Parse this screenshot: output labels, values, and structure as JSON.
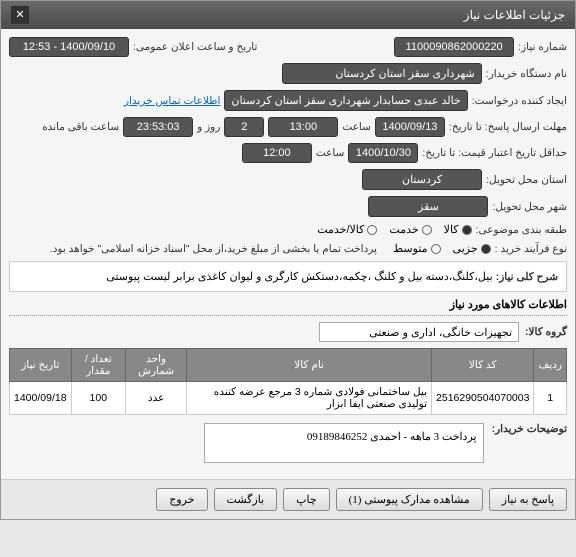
{
  "window": {
    "title": "جزئیات اطلاعات نیاز",
    "close": "✕"
  },
  "fields": {
    "need_number_label": "شماره نیاز:",
    "need_number_value": "1100090862000220",
    "announce_date_label": "تاریخ و ساعت اعلان عمومی:",
    "announce_date_value": "1400/09/10 - 12:53",
    "buyer_org_label": "نام دستگاه خریدار:",
    "buyer_org_value": "شهرداری سقز استان کردستان",
    "requester_label": "ایجاد کننده درخواست:",
    "requester_value": "خالد عبدی حسابدار شهرداری سقز استان کردستان",
    "contact_info_link": "اطلاعات تماس خریدار",
    "deadline_label": "مهلت ارسال پاسخ: تا تاریخ:",
    "deadline_date": "1400/09/13",
    "time_label": "ساعت",
    "deadline_time": "13:00",
    "days_value": "2",
    "days_label": "روز و",
    "remaining_time": "23:53:03",
    "remaining_label": "ساعت باقی مانده",
    "validity_label": "حداقل تاریخ اعتبار قیمت: تا تاریخ:",
    "validity_date": "1400/10/30",
    "validity_time": "12:00",
    "province_label": "استان محل تحویل:",
    "province_value": "کردستان",
    "city_label": "شهر محل تحویل:",
    "city_value": "سقز",
    "category_label": "طبقه بندی موضوعی:",
    "cat_kala": "کالا",
    "cat_service": "خدمت",
    "cat_both": "کالا/خدمت",
    "process_label": "نوع فرآیند خرید :",
    "proc_partial": "جزیی",
    "proc_medium": "متوسط",
    "payment_note": "پرداخت تمام یا بخشی از مبلغ خرید،از محل \"اسناد خزانه اسلامی\" خواهد بود.",
    "general_desc_label": "شرح کلی نیاز:",
    "general_desc_value": "بیل،کلنگ،دسته بیل  و کلنگ ،چکمه،دستکش کارگری و لیوان کاغذی برابر لیست پیوستی",
    "items_section": "اطلاعات کالاهای مورد نیاز",
    "group_label": "گروه کالا:",
    "group_value": "تجهیزات خانگی، اداری و صنعتی",
    "buyer_notes_label": "توضیحات خریدار:",
    "buyer_notes_value": "پرداخت 3 ماهه - احمدی 09189846252"
  },
  "table": {
    "headers": {
      "row": "ردیف",
      "code": "کد کالا",
      "name": "نام کالا",
      "unit": "واحد شمارش",
      "qty": "تعداد / مقدار",
      "date": "تاریخ نیاز"
    },
    "rows": [
      {
        "row": "1",
        "code": "2516290504070003",
        "name": "بیل ساختمانی فولادی شماره 3 مرجع عرضه کننده تولیدی صنعتی ایفا ابزار",
        "unit": "عدد",
        "qty": "100",
        "date": "1400/09/18"
      }
    ]
  },
  "buttons": {
    "respond": "پاسخ به نیاز",
    "attachments": "مشاهده مدارک پیوستی (1)",
    "print": "چاپ",
    "back": "بازگشت",
    "exit": "خروج"
  }
}
